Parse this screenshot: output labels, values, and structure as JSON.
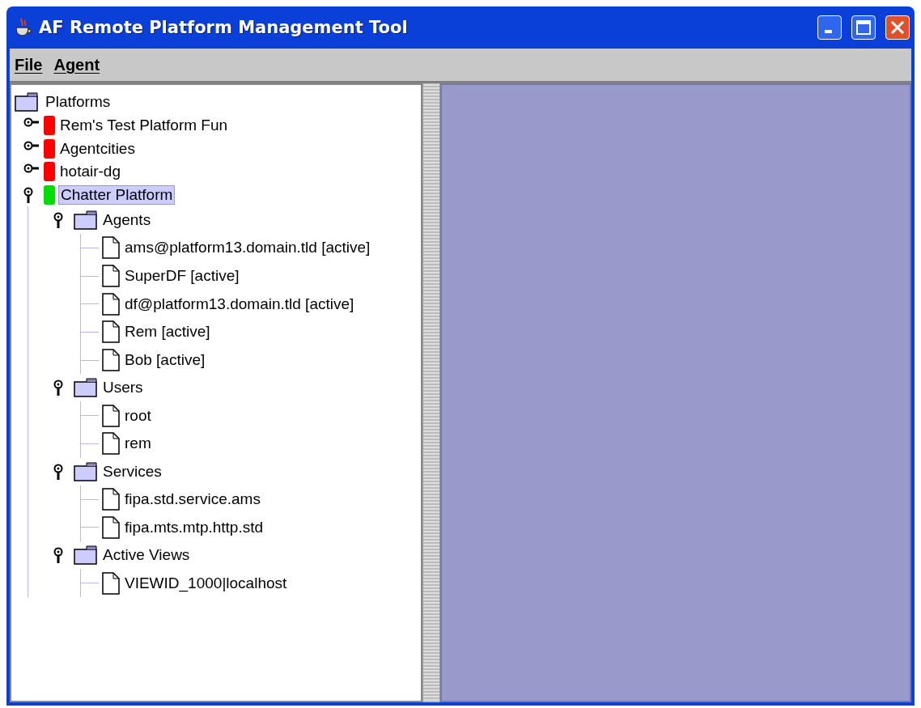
{
  "window": {
    "title": "AF Remote Platform Management Tool"
  },
  "menu": [
    {
      "label": "File"
    },
    {
      "label": "Agent"
    }
  ],
  "tree": {
    "label": "Platforms",
    "kind": "root",
    "children": [
      {
        "label": "Rem's Test Platform Fun",
        "kind": "platform",
        "color": "#ff0000",
        "expanded": false,
        "selected": false
      },
      {
        "label": "Agentcities",
        "kind": "platform",
        "color": "#ff0000",
        "expanded": false,
        "selected": false
      },
      {
        "label": "hotair-dg",
        "kind": "platform",
        "color": "#ff0000",
        "expanded": false,
        "selected": false
      },
      {
        "label": "Chatter Platform",
        "kind": "platform",
        "color": "#00dd00",
        "expanded": true,
        "selected": true,
        "children": [
          {
            "label": "Agents",
            "kind": "folder",
            "expanded": true,
            "children": [
              {
                "label": "ams@platform13.domain.tld [active]",
                "kind": "leaf"
              },
              {
                "label": "SuperDF [active]",
                "kind": "leaf"
              },
              {
                "label": "df@platform13.domain.tld [active]",
                "kind": "leaf"
              },
              {
                "label": "Rem [active]",
                "kind": "leaf"
              },
              {
                "label": "Bob [active]",
                "kind": "leaf"
              }
            ]
          },
          {
            "label": "Users",
            "kind": "folder",
            "expanded": true,
            "children": [
              {
                "label": "root",
                "kind": "leaf"
              },
              {
                "label": "rem",
                "kind": "leaf"
              }
            ]
          },
          {
            "label": "Services",
            "kind": "folder",
            "expanded": true,
            "children": [
              {
                "label": "fipa.std.service.ams",
                "kind": "leaf"
              },
              {
                "label": "fipa.mts.mtp.http.std",
                "kind": "leaf"
              }
            ]
          },
          {
            "label": "Active Views",
            "kind": "folder",
            "expanded": true,
            "children": [
              {
                "label": "VIEWID_1000|localhost",
                "kind": "leaf"
              }
            ]
          }
        ]
      }
    ]
  }
}
